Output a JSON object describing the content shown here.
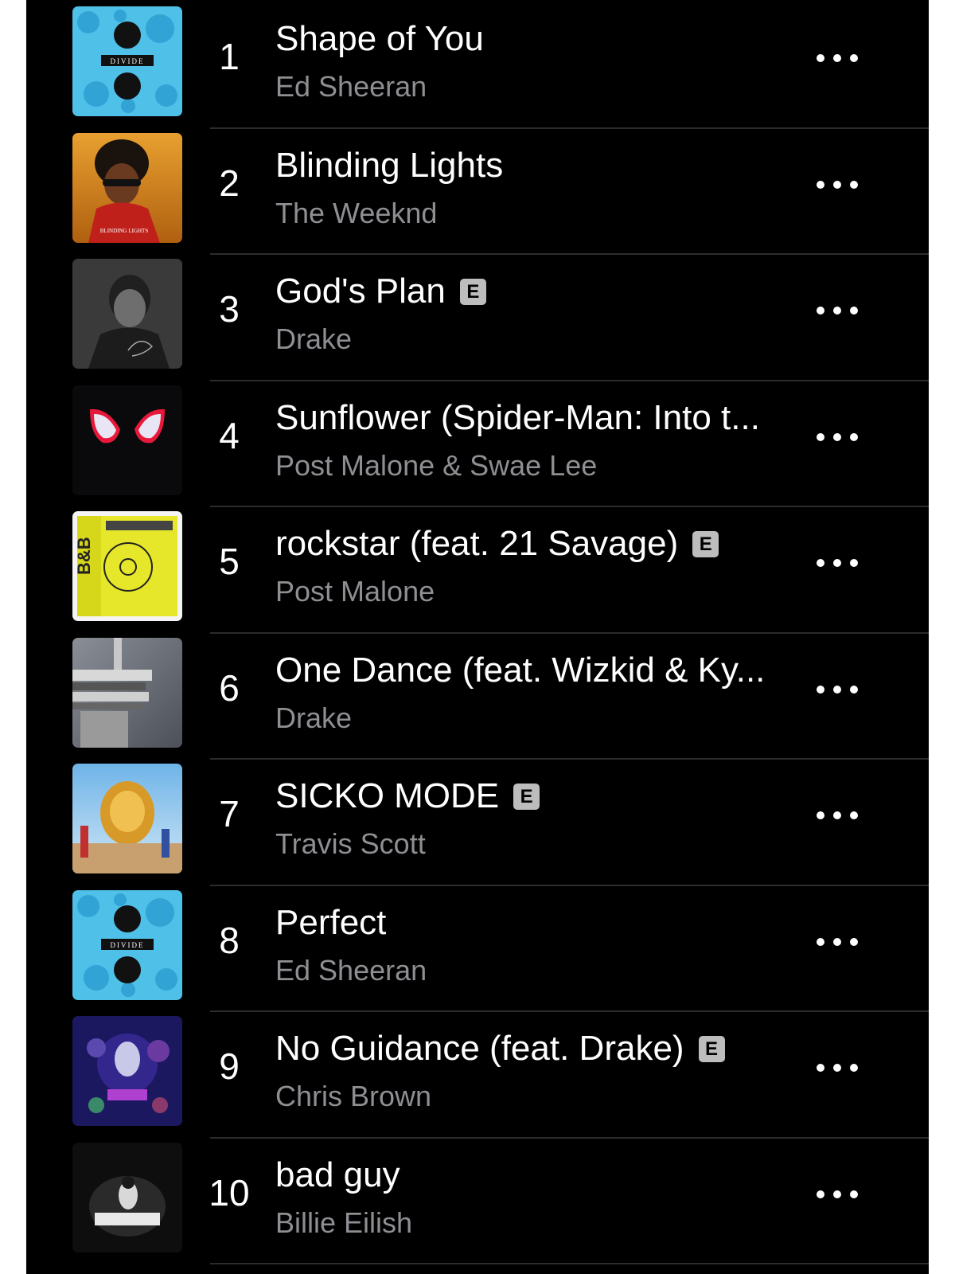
{
  "songs": [
    {
      "rank": "1",
      "title": "Shape of You",
      "artist": "Ed Sheeran",
      "explicit": false,
      "art": "divide-cover"
    },
    {
      "rank": "2",
      "title": "Blinding Lights",
      "artist": "The Weeknd",
      "explicit": false,
      "art": "blinding-lights-cover"
    },
    {
      "rank": "3",
      "title": "God's Plan",
      "artist": "Drake",
      "explicit": true,
      "art": "scorpion-cover"
    },
    {
      "rank": "4",
      "title": "Sunflower (Spider-Man: Into t...",
      "artist": "Post Malone & Swae Lee",
      "explicit": false,
      "art": "spider-verse-cover"
    },
    {
      "rank": "5",
      "title": "rockstar (feat. 21 Savage)",
      "artist": "Post Malone",
      "explicit": true,
      "art": "beerbongs-cover"
    },
    {
      "rank": "6",
      "title": "One Dance (feat. Wizkid & Ky...",
      "artist": "Drake",
      "explicit": false,
      "art": "views-cover"
    },
    {
      "rank": "7",
      "title": "SICKO MODE",
      "artist": "Travis Scott",
      "explicit": true,
      "art": "astroworld-cover"
    },
    {
      "rank": "8",
      "title": "Perfect",
      "artist": "Ed Sheeran",
      "explicit": false,
      "art": "divide-cover"
    },
    {
      "rank": "9",
      "title": "No Guidance (feat. Drake)",
      "artist": "Chris Brown",
      "explicit": true,
      "art": "indigo-cover"
    },
    {
      "rank": "10",
      "title": "bad guy",
      "artist": "Billie Eilish",
      "explicit": false,
      "art": "when-we-all-fall-asleep-cover"
    }
  ],
  "explicit_label": "E",
  "art_text": {
    "divide": "DIVIDE",
    "blinding": "BLINDING LIGHTS"
  },
  "colors": {
    "background": "#000000",
    "title": "#ffffff",
    "subtitle": "#8e8e93",
    "separator": "#2c2c2e",
    "explicit_badge": "#bdbdbd"
  }
}
